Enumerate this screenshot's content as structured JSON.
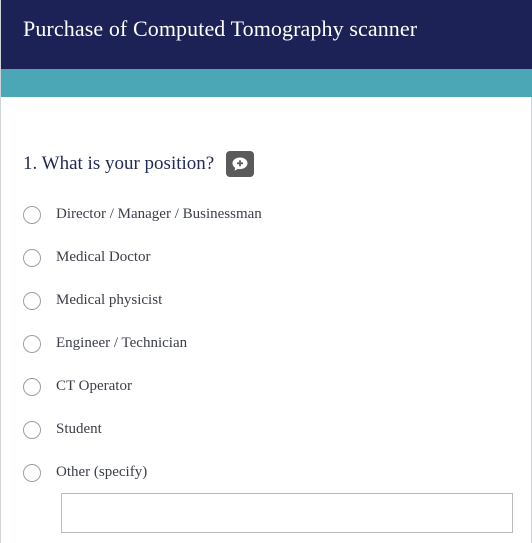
{
  "header": {
    "title": "Purchase of Computed Tomography scanner"
  },
  "question": {
    "text": "1. What is your position?",
    "comment_icon": "comment-bubble-icon",
    "options": [
      {
        "label": "Director / Manager / Businessman",
        "selected": false
      },
      {
        "label": "Medical Doctor",
        "selected": false
      },
      {
        "label": "Medical physicist",
        "selected": false
      },
      {
        "label": "Engineer / Technician",
        "selected": false
      },
      {
        "label": "CT Operator",
        "selected": false
      },
      {
        "label": "Student",
        "selected": false
      },
      {
        "label": "Other (specify)",
        "selected": false
      }
    ],
    "specify_value": ""
  },
  "colors": {
    "header_bg": "#1d2256",
    "band": "#4ba6b6",
    "question_text": "#1f2a55",
    "option_text": "#3b3f4a"
  }
}
